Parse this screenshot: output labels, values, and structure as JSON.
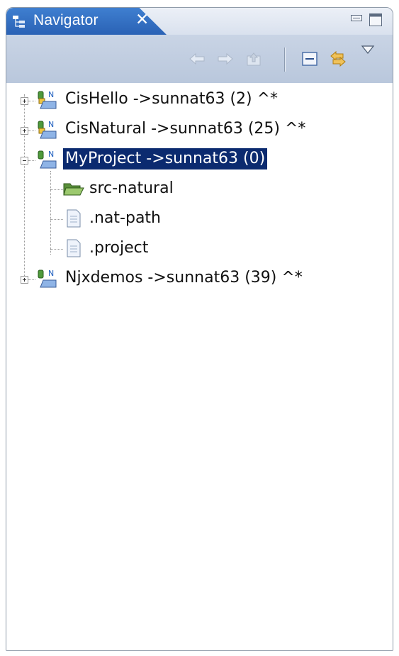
{
  "view": {
    "title": "Navigator",
    "close_glyph": "✕",
    "icon": "navigator-icon"
  },
  "toolbar": {
    "back": "back-arrow-icon",
    "forward": "forward-arrow-icon",
    "up": "up-folder-icon",
    "collapse": "collapse-all-icon",
    "link": "link-with-editor-icon",
    "menu": "view-menu-icon"
  },
  "tree": {
    "items": [
      {
        "label": "CisHello ->sunnat63 (2) ^*",
        "expanded": false,
        "selected": false
      },
      {
        "label": "CisNatural ->sunnat63 (25) ^*",
        "expanded": false,
        "selected": false
      },
      {
        "label": "MyProject ->sunnat63 (0)",
        "expanded": true,
        "selected": true,
        "children": [
          {
            "label": "src-natural",
            "type": "folder"
          },
          {
            "label": ".nat-path",
            "type": "file"
          },
          {
            "label": ".project",
            "type": "file"
          }
        ]
      },
      {
        "label": "Njxdemos ->sunnat63 (39) ^*",
        "expanded": false,
        "selected": false
      }
    ]
  },
  "colors": {
    "tab_active": "#2a62b5",
    "selection": "#0b2a6f",
    "toolbar": "#c3cfe2"
  }
}
